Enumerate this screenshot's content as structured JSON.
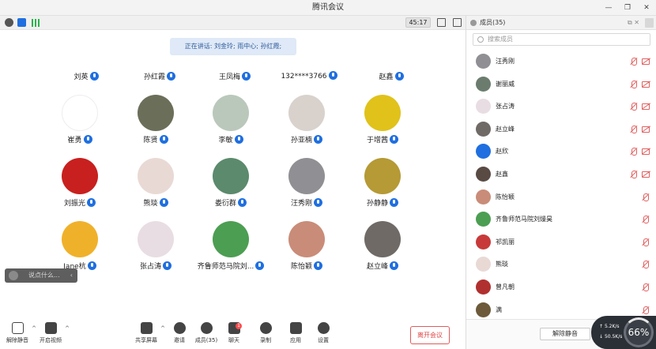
{
  "window": {
    "title": "腾讯会议"
  },
  "top": {
    "timer": "45:17"
  },
  "speaking": "正在讲话: 刘金玲; 雨中心; 孙红霞;",
  "name_row": [
    "刘英",
    "孙红霞",
    "王凤梅",
    "132****3766",
    "赵鑫"
  ],
  "grid": [
    {
      "name": "崔勇",
      "color": "#ffffff"
    },
    {
      "name": "陈贤",
      "color": "#6b6f5a"
    },
    {
      "name": "李敏",
      "color": "#b9c8bb"
    },
    {
      "name": "孙亚楠",
      "color": "#d9d2cc"
    },
    {
      "name": "于增茜",
      "color": "#e0c21a"
    },
    {
      "name": "刘振光",
      "color": "#c8201e"
    },
    {
      "name": "熊琰",
      "color": "#e9d9d5"
    },
    {
      "name": "娄衍群",
      "color": "#5b8a6c"
    },
    {
      "name": "汪秀刚",
      "color": "#8f8f94"
    },
    {
      "name": "孙静静",
      "color": "#b59a35"
    },
    {
      "name": "Jane杭",
      "color": "#f0b12a"
    },
    {
      "name": "张占涛",
      "color": "#e8dde3"
    },
    {
      "name": "齐鲁师范马院刘...",
      "color": "#4c9e52"
    },
    {
      "name": "陈怡颖",
      "color": "#c98c78"
    },
    {
      "name": "赵立峰",
      "color": "#6f6a66"
    }
  ],
  "chat": {
    "placeholder": "说点什么..."
  },
  "toolbar": {
    "unmute": "解除静音",
    "video": "开启视频",
    "share": "共享屏幕",
    "invite": "邀请",
    "members": "成员(35)",
    "chat": "聊天",
    "chat_badge": "1",
    "record": "录制",
    "apps": "应用",
    "settings": "设置",
    "leave": "离开会议"
  },
  "panel": {
    "title": "成员(35)",
    "search_placeholder": "搜索成员",
    "members": [
      {
        "name": "汪秀刚",
        "color": "#8f8f94",
        "video": true
      },
      {
        "name": "谢丽威",
        "color": "#6b7c6e",
        "video": true
      },
      {
        "name": "张占涛",
        "color": "#e8dde3",
        "video": true
      },
      {
        "name": "赵立峰",
        "color": "#6f6a66",
        "video": true
      },
      {
        "name": "赵欣",
        "color": "#1f6fe0",
        "video": true
      },
      {
        "name": "赵鑫",
        "color": "#5a4a44",
        "video": true
      },
      {
        "name": "陈怡颖",
        "color": "#c98c78",
        "video": false
      },
      {
        "name": "齐鲁师范马院刘熳昊",
        "color": "#4c9e52",
        "video": false
      },
      {
        "name": "祁凯丽",
        "color": "#c83a3a",
        "video": false
      },
      {
        "name": "熊琰",
        "color": "#e9d9d5",
        "video": false
      },
      {
        "name": "曾凡朝",
        "color": "#b0302f",
        "video": false
      },
      {
        "name": "满",
        "color": "#6c5a3a",
        "video": false
      }
    ],
    "mute_all": "解除静音"
  },
  "network": {
    "up": "5.2K/s",
    "down": "50.5K/s",
    "score": "66%"
  }
}
